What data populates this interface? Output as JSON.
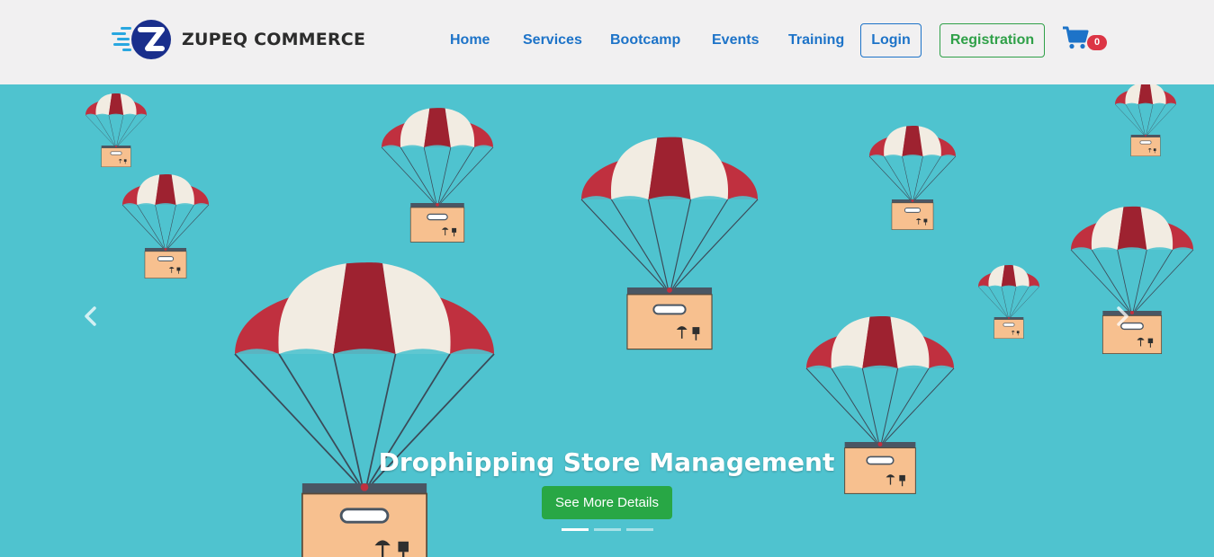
{
  "brand": {
    "name": "ZUPEQ COMMERCE",
    "logo_icon": "z-logo-icon"
  },
  "nav": {
    "items": [
      {
        "label": "Home"
      },
      {
        "label": "Services"
      },
      {
        "label": "Bootcamp"
      },
      {
        "label": "Events"
      },
      {
        "label": "Training"
      }
    ],
    "login_label": "Login",
    "registration_label": "Registration",
    "cart": {
      "icon": "shopping-cart-icon",
      "count": "0"
    }
  },
  "carousel": {
    "caption": "Drophipping Store Management",
    "cta_label": "See More Details",
    "prev_icon": "chevron-left-icon",
    "next_icon": "chevron-right-icon",
    "slides_count": 3,
    "active_slide": 0
  },
  "colors": {
    "nav_bg": "#f1f0f1",
    "nav_link": "#1d73c8",
    "hero_bg": "#4fc3cf",
    "primary": "#1d73c8",
    "success": "#28a745",
    "badge": "#dc3545",
    "parachute_red": "#c0303f",
    "parachute_white": "#f2ece2",
    "box": "#f7c08f"
  }
}
